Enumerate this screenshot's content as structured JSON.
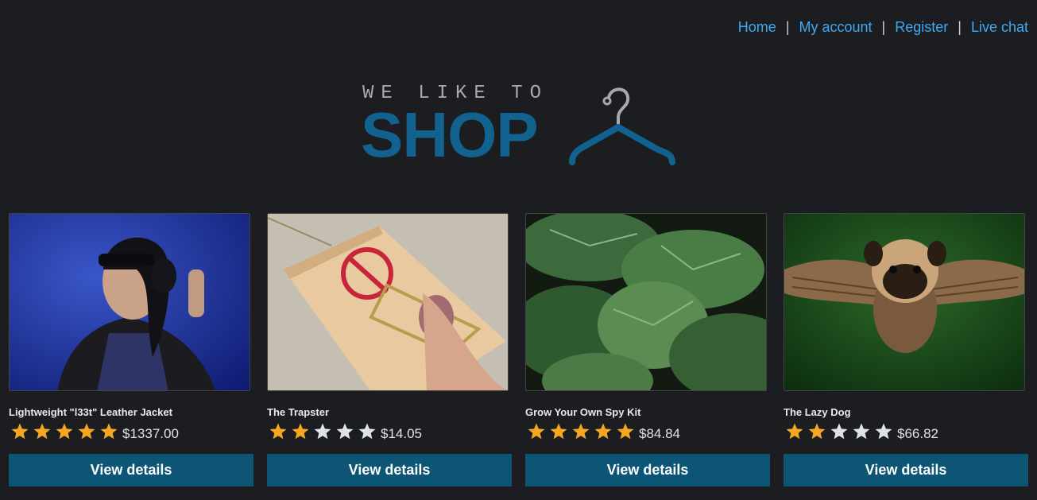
{
  "nav": {
    "home": "Home",
    "account": "My account",
    "register": "Register",
    "chat": "Live chat",
    "separator": "|"
  },
  "logo": {
    "tagline": "WE LIKE TO",
    "word": "SHOP",
    "icon": "hanger-icon"
  },
  "products": [
    {
      "name": "Lightweight \"l33t\" Leather Jacket",
      "rating": 5,
      "price": "$1337.00",
      "button": "View details"
    },
    {
      "name": "The Trapster",
      "rating": 2,
      "price": "$14.05",
      "button": "View details"
    },
    {
      "name": "Grow Your Own Spy Kit",
      "rating": 5,
      "price": "$84.84",
      "button": "View details"
    },
    {
      "name": "The Lazy Dog",
      "rating": 2,
      "price": "$66.82",
      "button": "View details"
    }
  ],
  "colors": {
    "background": "#1c1d20",
    "link": "#3fa9f5",
    "brand": "#12628f",
    "button": "#0d5575",
    "star_filled": "#f5a623",
    "star_empty": "#dfe3e6"
  }
}
